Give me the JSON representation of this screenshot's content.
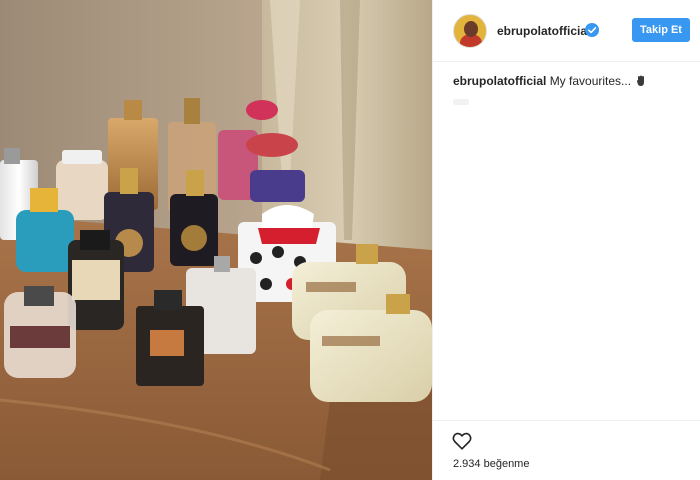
{
  "post": {
    "photo_alt": "",
    "username": "ebrupolatofficial",
    "verified": true,
    "follow_label": "Takip Et",
    "caption_username": "ebrupolatofficial",
    "caption_text": "My favourites...",
    "likes_count": "2.934",
    "likes_word": "beğenme"
  },
  "colors": {
    "follow_button": "#3897f0",
    "verified_badge": "#3897f0",
    "text": "#262626",
    "divider": "#efefef"
  },
  "icons": {
    "verified": "verified-badge-icon",
    "like": "heart-outline-icon",
    "caption_emoji": "hand-emoji-icon"
  }
}
